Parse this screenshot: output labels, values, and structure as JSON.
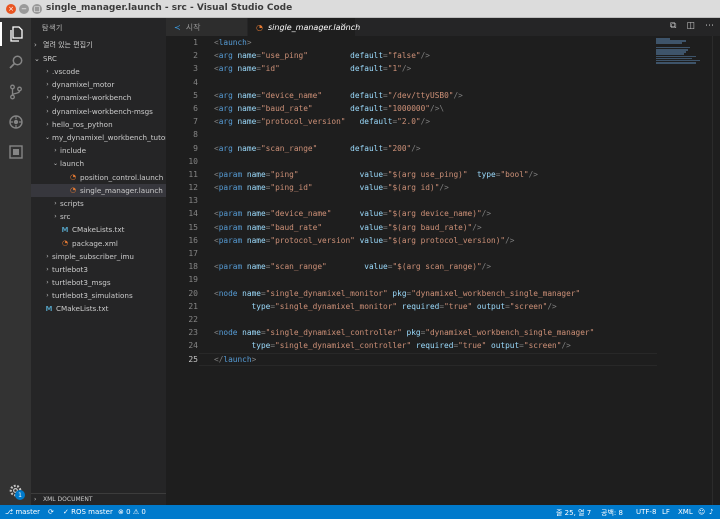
{
  "window": {
    "title": "single_manager.launch - src - Visual Studio Code",
    "close_glyph": "×",
    "min_glyph": "−",
    "max_glyph": "□"
  },
  "activity_bar": {
    "items": [
      {
        "name": "explorer",
        "icon": "files-icon"
      },
      {
        "name": "search",
        "icon": "search-icon"
      },
      {
        "name": "source-control",
        "icon": "git-branch-icon"
      },
      {
        "name": "debug",
        "icon": "debug-icon"
      },
      {
        "name": "extensions",
        "icon": "extensions-icon"
      }
    ],
    "settings_badge": "1"
  },
  "sidebar": {
    "header": "탐색기",
    "open_editors_label": "열려 있는 편집기",
    "root_label": "SRC",
    "tree": [
      {
        "label": ".vscode",
        "depth": 1,
        "chevron": "›",
        "type": "folder"
      },
      {
        "label": "dynamixel_motor",
        "depth": 1,
        "chevron": "›",
        "type": "folder"
      },
      {
        "label": "dynamixel-workbench",
        "depth": 1,
        "chevron": "›",
        "type": "folder"
      },
      {
        "label": "dynamixel-workbench-msgs",
        "depth": 1,
        "chevron": "›",
        "type": "folder"
      },
      {
        "label": "hello_ros_python",
        "depth": 1,
        "chevron": "›",
        "type": "folder"
      },
      {
        "label": "my_dynamixel_workbench_tutor...",
        "depth": 1,
        "chevron": "⌄",
        "type": "folder"
      },
      {
        "label": "include",
        "depth": 2,
        "chevron": "›",
        "type": "folder"
      },
      {
        "label": "launch",
        "depth": 2,
        "chevron": "⌄",
        "type": "folder"
      },
      {
        "label": "position_control.launch",
        "depth": 3,
        "chevron": "",
        "type": "xml"
      },
      {
        "label": "single_manager.launch",
        "depth": 3,
        "chevron": "",
        "type": "xml",
        "selected": true
      },
      {
        "label": "scripts",
        "depth": 2,
        "chevron": "›",
        "type": "folder"
      },
      {
        "label": "src",
        "depth": 2,
        "chevron": "›",
        "type": "folder"
      },
      {
        "label": "CMakeLists.txt",
        "depth": 2,
        "chevron": "",
        "type": "cmake"
      },
      {
        "label": "package.xml",
        "depth": 2,
        "chevron": "",
        "type": "xml"
      },
      {
        "label": "simple_subscriber_imu",
        "depth": 1,
        "chevron": "›",
        "type": "folder"
      },
      {
        "label": "turtlebot3",
        "depth": 1,
        "chevron": "›",
        "type": "folder"
      },
      {
        "label": "turtlebot3_msgs",
        "depth": 1,
        "chevron": "›",
        "type": "folder"
      },
      {
        "label": "turtlebot3_simulations",
        "depth": 1,
        "chevron": "›",
        "type": "folder"
      },
      {
        "label": "CMakeLists.txt",
        "depth": 0,
        "chevron": "",
        "type": "cmake"
      }
    ],
    "bottom_section": "XML DOCUMENT"
  },
  "tabs": [
    {
      "label": "시작",
      "icon": "vscode-icon",
      "active": false
    },
    {
      "label": "single_manager.launch",
      "icon": "rss-icon",
      "active": true,
      "close": "×"
    }
  ],
  "editor": {
    "current_line": 25,
    "lines": [
      [
        [
          "pu",
          "<"
        ],
        [
          "tg",
          "launch"
        ],
        [
          "pu",
          ">"
        ]
      ],
      [
        [
          "pu",
          "<"
        ],
        [
          "tg",
          "arg"
        ],
        [
          "at",
          " name"
        ],
        [
          "pu",
          "="
        ],
        [
          "st",
          "\"use_ping\""
        ],
        [
          "at",
          "         default"
        ],
        [
          "pu",
          "="
        ],
        [
          "st",
          "\"false\""
        ],
        [
          "pu",
          "/>"
        ]
      ],
      [
        [
          "pu",
          "<"
        ],
        [
          "tg",
          "arg"
        ],
        [
          "at",
          " name"
        ],
        [
          "pu",
          "="
        ],
        [
          "st",
          "\"id\""
        ],
        [
          "at",
          "               default"
        ],
        [
          "pu",
          "="
        ],
        [
          "st",
          "\"1\""
        ],
        [
          "pu",
          "/>"
        ]
      ],
      [],
      [
        [
          "pu",
          "<"
        ],
        [
          "tg",
          "arg"
        ],
        [
          "at",
          " name"
        ],
        [
          "pu",
          "="
        ],
        [
          "st",
          "\"device_name\""
        ],
        [
          "at",
          "      default"
        ],
        [
          "pu",
          "="
        ],
        [
          "st",
          "\"/dev/ttyUSB0\""
        ],
        [
          "pu",
          "/>"
        ]
      ],
      [
        [
          "pu",
          "<"
        ],
        [
          "tg",
          "arg"
        ],
        [
          "at",
          " name"
        ],
        [
          "pu",
          "="
        ],
        [
          "st",
          "\"baud_rate\""
        ],
        [
          "at",
          "        default"
        ],
        [
          "pu",
          "="
        ],
        [
          "st",
          "\"1000000\""
        ],
        [
          "pu",
          "/>\\"
        ]
      ],
      [
        [
          "pu",
          "<"
        ],
        [
          "tg",
          "arg"
        ],
        [
          "at",
          " name"
        ],
        [
          "pu",
          "="
        ],
        [
          "st",
          "\"protocol_version\""
        ],
        [
          "at",
          "   default"
        ],
        [
          "pu",
          "="
        ],
        [
          "st",
          "\"2.0\""
        ],
        [
          "pu",
          "/>"
        ]
      ],
      [],
      [
        [
          "pu",
          "<"
        ],
        [
          "tg",
          "arg"
        ],
        [
          "at",
          " name"
        ],
        [
          "pu",
          "="
        ],
        [
          "st",
          "\"scan_range\""
        ],
        [
          "at",
          "       default"
        ],
        [
          "pu",
          "="
        ],
        [
          "st",
          "\"200\""
        ],
        [
          "pu",
          "/>"
        ]
      ],
      [],
      [
        [
          "pu",
          "<"
        ],
        [
          "tg",
          "param"
        ],
        [
          "at",
          " name"
        ],
        [
          "pu",
          "="
        ],
        [
          "st",
          "\"ping\""
        ],
        [
          "at",
          "             value"
        ],
        [
          "pu",
          "="
        ],
        [
          "st",
          "\"$(arg use_ping)\""
        ],
        [
          "at",
          "  type"
        ],
        [
          "pu",
          "="
        ],
        [
          "st",
          "\"bool\""
        ],
        [
          "pu",
          "/>"
        ]
      ],
      [
        [
          "pu",
          "<"
        ],
        [
          "tg",
          "param"
        ],
        [
          "at",
          " name"
        ],
        [
          "pu",
          "="
        ],
        [
          "st",
          "\"ping_id\""
        ],
        [
          "at",
          "          value"
        ],
        [
          "pu",
          "="
        ],
        [
          "st",
          "\"$(arg id)\""
        ],
        [
          "pu",
          "/>"
        ]
      ],
      [],
      [
        [
          "pu",
          "<"
        ],
        [
          "tg",
          "param"
        ],
        [
          "at",
          " name"
        ],
        [
          "pu",
          "="
        ],
        [
          "st",
          "\"device_name\""
        ],
        [
          "at",
          "      value"
        ],
        [
          "pu",
          "="
        ],
        [
          "st",
          "\"$(arg device_name)\""
        ],
        [
          "pu",
          "/>"
        ]
      ],
      [
        [
          "pu",
          "<"
        ],
        [
          "tg",
          "param"
        ],
        [
          "at",
          " name"
        ],
        [
          "pu",
          "="
        ],
        [
          "st",
          "\"baud_rate\""
        ],
        [
          "at",
          "        value"
        ],
        [
          "pu",
          "="
        ],
        [
          "st",
          "\"$(arg baud_rate)\""
        ],
        [
          "pu",
          "/>"
        ]
      ],
      [
        [
          "pu",
          "<"
        ],
        [
          "tg",
          "param"
        ],
        [
          "at",
          " name"
        ],
        [
          "pu",
          "="
        ],
        [
          "st",
          "\"protocol_version\""
        ],
        [
          "at",
          " value"
        ],
        [
          "pu",
          "="
        ],
        [
          "st",
          "\"$(arg protocol_version)\""
        ],
        [
          "pu",
          "/>"
        ]
      ],
      [],
      [
        [
          "pu",
          "<"
        ],
        [
          "tg",
          "param"
        ],
        [
          "at",
          " name"
        ],
        [
          "pu",
          "="
        ],
        [
          "st",
          "\"scan_range\""
        ],
        [
          "at",
          "        value"
        ],
        [
          "pu",
          "="
        ],
        [
          "st",
          "\"$(arg scan_range)\""
        ],
        [
          "pu",
          "/>"
        ]
      ],
      [],
      [
        [
          "pu",
          "<"
        ],
        [
          "tg",
          "node"
        ],
        [
          "at",
          " name"
        ],
        [
          "pu",
          "="
        ],
        [
          "st",
          "\"single_dynamixel_monitor\""
        ],
        [
          "at",
          " pkg"
        ],
        [
          "pu",
          "="
        ],
        [
          "st",
          "\"dynamixel_workbench_single_manager\""
        ]
      ],
      [
        [
          "at",
          "        type"
        ],
        [
          "pu",
          "="
        ],
        [
          "st",
          "\"single_dynamixel_monitor\""
        ],
        [
          "at",
          " required"
        ],
        [
          "pu",
          "="
        ],
        [
          "st",
          "\"true\""
        ],
        [
          "at",
          " output"
        ],
        [
          "pu",
          "="
        ],
        [
          "st",
          "\"screen\""
        ],
        [
          "pu",
          "/>"
        ]
      ],
      [],
      [
        [
          "pu",
          "<"
        ],
        [
          "tg",
          "node"
        ],
        [
          "at",
          " name"
        ],
        [
          "pu",
          "="
        ],
        [
          "st",
          "\"single_dynamixel_controller\""
        ],
        [
          "at",
          " pkg"
        ],
        [
          "pu",
          "="
        ],
        [
          "st",
          "\"dynamixel_workbench_single_manager\""
        ]
      ],
      [
        [
          "at",
          "        type"
        ],
        [
          "pu",
          "="
        ],
        [
          "st",
          "\"single_dynamixel_controller\""
        ],
        [
          "at",
          " required"
        ],
        [
          "pu",
          "="
        ],
        [
          "st",
          "\"true\""
        ],
        [
          "at",
          " output"
        ],
        [
          "pu",
          "="
        ],
        [
          "st",
          "\"screen\""
        ],
        [
          "pu",
          "/>"
        ]
      ],
      [
        [
          "pu",
          "</"
        ],
        [
          "tg",
          "launch"
        ],
        [
          "pu",
          ">"
        ]
      ]
    ]
  },
  "statusbar": {
    "branch_icon": "git-branch-icon",
    "branch": "master",
    "ros_status": "ROS master",
    "errors": "0",
    "warnings": "0",
    "cursor_position": "줄 25, 열 7",
    "indent": "공백: 8",
    "encoding": "UTF-8",
    "eol": "LF",
    "language": "XML",
    "feedback_icon": "smiley-icon",
    "bell_icon": "bell-icon"
  }
}
